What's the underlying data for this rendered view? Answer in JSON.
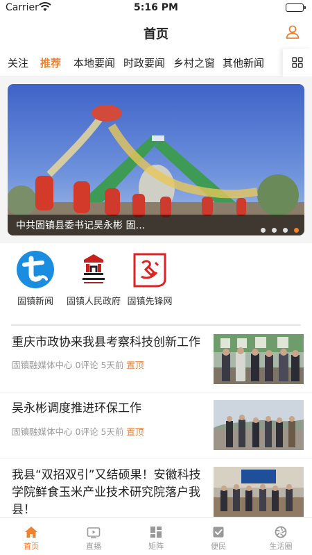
{
  "status_bar": {
    "carrier": "Carrier",
    "time": "5:16 PM"
  },
  "nav": {
    "title": "首页",
    "profile_icon": "person-icon"
  },
  "channels": {
    "active_color": "#f0812f",
    "items": [
      {
        "label": "关注",
        "active": false
      },
      {
        "label": "推荐",
        "active": true
      },
      {
        "label": "本地要闻",
        "active": false
      },
      {
        "label": "时政要闻",
        "active": false
      },
      {
        "label": "乡村之窗",
        "active": false
      },
      {
        "label": "其他新闻",
        "active": false
      }
    ],
    "more_icon": "grid-icon"
  },
  "banner": {
    "caption": "中共固镇县委书记吴永彬 固…",
    "slide_count": 4,
    "active_slide": 4
  },
  "shortcuts": [
    {
      "label": "固镇新闻",
      "icon": "guzhen-news-logo"
    },
    {
      "label": "固镇人民政府",
      "icon": "government-emblem-logo"
    },
    {
      "label": "固镇先锋网",
      "icon": "party-flag-logo"
    }
  ],
  "news": [
    {
      "title": "重庆市政协来我县考察科技创新工作",
      "source": "固镇融媒体中心",
      "comments": "0评论",
      "time": "5天前",
      "pin": "置顶"
    },
    {
      "title": "吴永彬调度推进环保工作",
      "source": "固镇融媒体中心",
      "comments": "0评论",
      "time": "5天前",
      "pin": "置顶"
    },
    {
      "title": "我县“双招双引”又结硕果！安徽科技学院鲜食玉米产业技术研究院落户我县！",
      "source": "",
      "comments": "",
      "time": "",
      "pin": ""
    }
  ],
  "tab_bar": {
    "items": [
      {
        "label": "首页",
        "icon": "home-icon",
        "active": true
      },
      {
        "label": "直播",
        "icon": "tv-icon",
        "active": false
      },
      {
        "label": "矩阵",
        "icon": "matrix-icon",
        "active": false
      },
      {
        "label": "便民",
        "icon": "checkbox-icon",
        "active": false
      },
      {
        "label": "生活圈",
        "icon": "aperture-icon",
        "active": false
      }
    ]
  }
}
